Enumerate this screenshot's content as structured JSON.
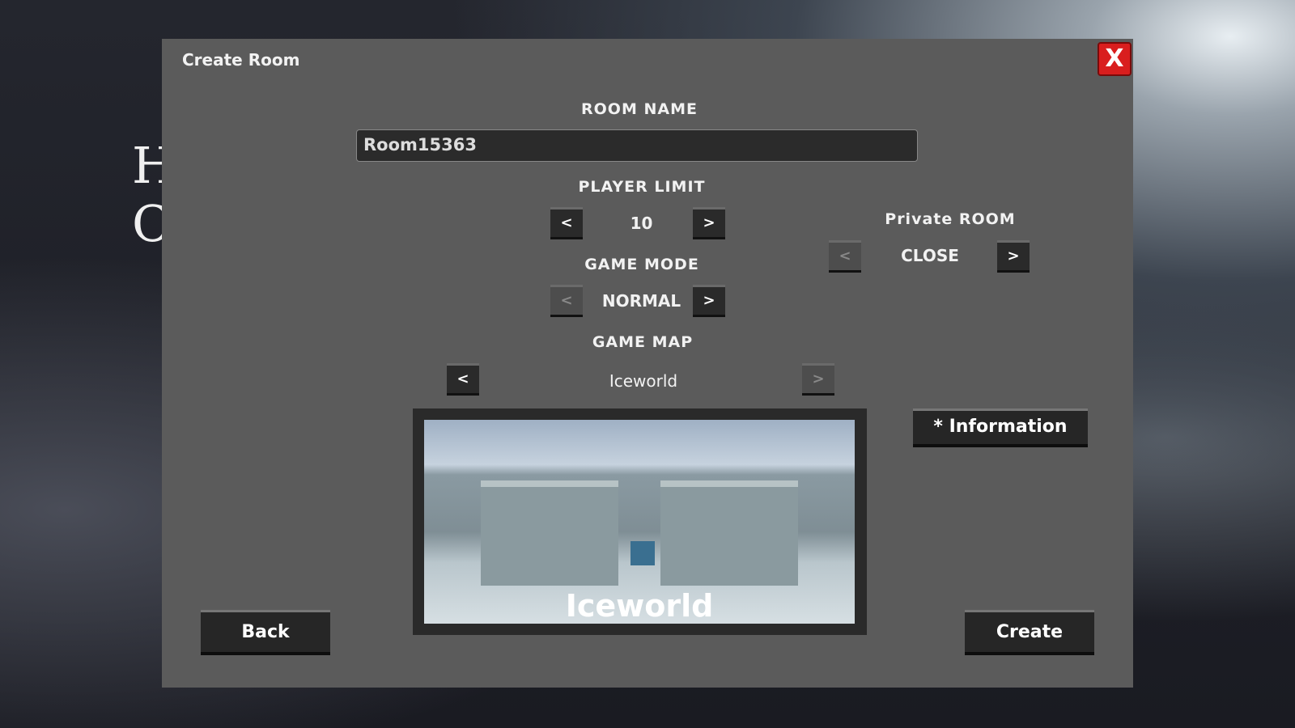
{
  "background": {
    "logo_line1": "H",
    "logo_line2": "C"
  },
  "dialog": {
    "title": "Create Room",
    "close_label": "X",
    "room_name": {
      "label": "ROOM NAME",
      "value": "Room15363"
    },
    "player_limit": {
      "label": "PLAYER LIMIT",
      "value": "10",
      "prev": "<",
      "next": ">"
    },
    "game_mode": {
      "label": "GAME MODE",
      "value": "NORMAL",
      "prev": "<",
      "next": ">"
    },
    "private_room": {
      "label": "Private ROOM",
      "value": "CLOSE",
      "prev": "<",
      "next": ">"
    },
    "game_map": {
      "label": "GAME MAP",
      "value": "Iceworld",
      "prev": "<",
      "next": ">",
      "preview_caption": "Iceworld"
    },
    "information_label": "* Information",
    "back_label": "Back",
    "create_label": "Create",
    "colors": {
      "panel": "#5b5b5b",
      "close": "#d91e1e",
      "button": "#262626"
    }
  }
}
